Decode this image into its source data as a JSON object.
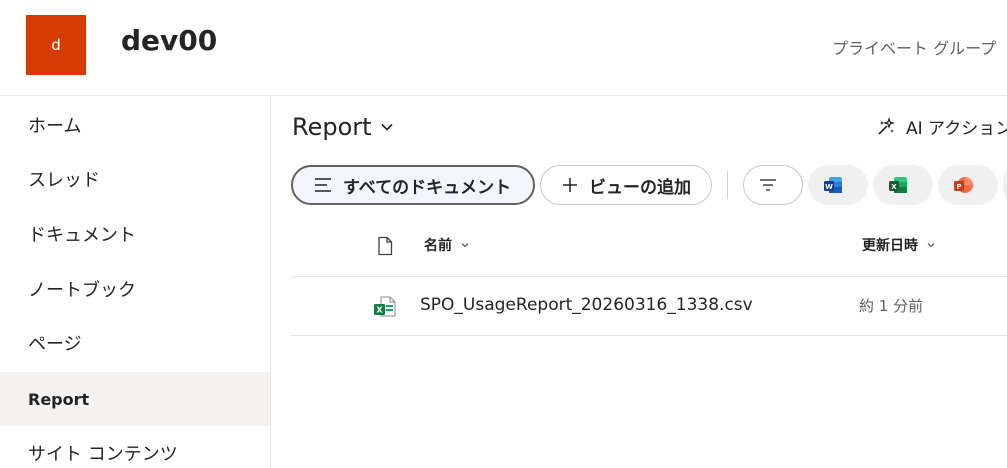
{
  "site": {
    "logo_letter": "d",
    "title": "dev00",
    "privacy": "プライベート グループ"
  },
  "colors": {
    "logo_bg": "#d83b01",
    "selected_nav_bg": "#f3f2f1",
    "excel_green": "#107c41",
    "word_blue": "#185abd",
    "ppt_red": "#c43e1c"
  },
  "nav": {
    "items": [
      {
        "label": "ホーム"
      },
      {
        "label": "スレッド"
      },
      {
        "label": "ドキュメント"
      },
      {
        "label": "ノートブック"
      },
      {
        "label": "ページ"
      },
      {
        "label": "Report",
        "selected": true
      },
      {
        "label": "サイト コンテンツ"
      }
    ]
  },
  "library": {
    "title": "Report",
    "ai_actions": "AI アクション"
  },
  "toolbar": {
    "all_documents": "すべてのドキュメント",
    "add_view": "ビューの追加",
    "icons": [
      "list-icon",
      "plus-icon",
      "filter-icon",
      "word-icon",
      "excel-icon",
      "powerpoint-icon"
    ]
  },
  "columns": {
    "name": "名前",
    "modified": "更新日時"
  },
  "files": [
    {
      "name": "SPO_UsageReport_20260316_1338.csv",
      "modified": "約 1 分前",
      "icon": "excel-csv-icon"
    }
  ]
}
